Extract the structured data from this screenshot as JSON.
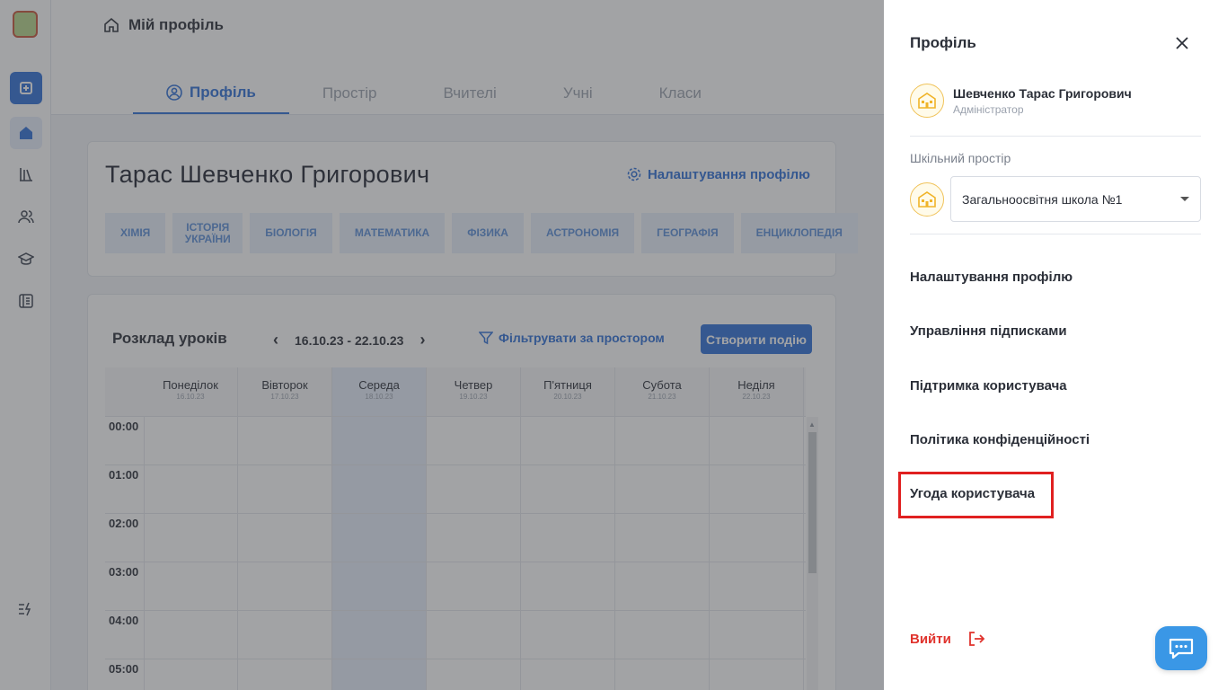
{
  "breadcrumb": {
    "title": "Мій профіль"
  },
  "tabs": [
    {
      "label": "Профіль"
    },
    {
      "label": "Простір"
    },
    {
      "label": "Вчителі"
    },
    {
      "label": "Учні"
    },
    {
      "label": "Класи"
    }
  ],
  "profile": {
    "name": "Тарас Шевченко Григорович",
    "settings_link": "Налаштування профілю",
    "subjects": [
      "ХІМІЯ",
      "ІСТОРІЯ УКРАЇНИ",
      "БІОЛОГІЯ",
      "МАТЕМАТИКА",
      "ФІЗИКА",
      "АСТРОНОМІЯ",
      "ГЕОГРАФІЯ",
      "ЕНЦИКЛОПЕДІЯ"
    ]
  },
  "schedule": {
    "title": "Розклад уроків",
    "range": "16.10.23 - 22.10.23",
    "prev": "‹",
    "next": "›",
    "filter": "Фільтрувати за простором",
    "create": "Створити подію",
    "days": [
      {
        "name": "Понеділок",
        "date": "16.10.23"
      },
      {
        "name": "Вівторок",
        "date": "17.10.23"
      },
      {
        "name": "Середа",
        "date": "18.10.23"
      },
      {
        "name": "Четвер",
        "date": "19.10.23"
      },
      {
        "name": "П'ятниця",
        "date": "20.10.23"
      },
      {
        "name": "Субота",
        "date": "21.10.23"
      },
      {
        "name": "Неділя",
        "date": "22.10.23"
      }
    ],
    "hours": [
      "00:00",
      "01:00",
      "02:00",
      "03:00",
      "04:00",
      "05:00"
    ]
  },
  "drawer": {
    "title": "Профіль",
    "user_name": "Шевченко Тарас Григорович",
    "user_role": "Адміністратор",
    "space_label": "Шкільний простір",
    "space_value": "Загальноосвітня школа №1",
    "menu": [
      "Налаштування профілю",
      "Управління підписками",
      "Підтримка користувача",
      "Політика конфіденційності",
      "Угода користувача"
    ],
    "logout": "Вийти"
  },
  "colors": {
    "accent": "#2f6fd6",
    "logout": "#e0332d",
    "highlight": "#e02020",
    "chat": "#3a97e6"
  }
}
